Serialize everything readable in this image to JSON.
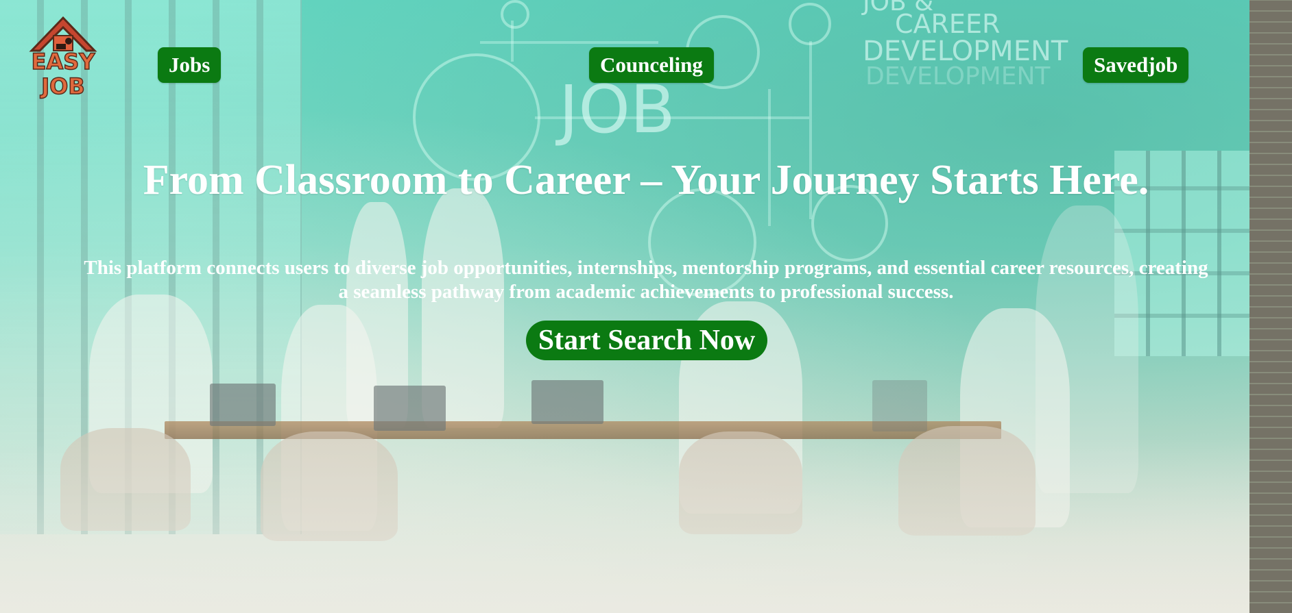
{
  "header": {
    "logo": {
      "line1": "EASY",
      "line2": "JOB"
    },
    "nav": [
      {
        "label": "Jobs"
      },
      {
        "label": "Counceling"
      },
      {
        "label": "Savedjob"
      }
    ]
  },
  "hero": {
    "background_text": {
      "job": "JOB",
      "career_line1": "JOB &",
      "career_line2": "CAREER",
      "career_line3": "DEVELOPMENT",
      "career_line4": "DEVELOPMENT"
    },
    "headline": "From Classroom to Career – Your Journey Starts Here.",
    "subtitle": "This platform connects users to diverse job opportunities, internships, mentorship programs, and essential career resources, creating a seamless pathway from academic achievements to professional success.",
    "cta_label": "Start Search Now"
  },
  "colors": {
    "button_green": "#0b7a12",
    "text_white": "#ffffff",
    "overlay_teal": "#6fd2bd"
  }
}
